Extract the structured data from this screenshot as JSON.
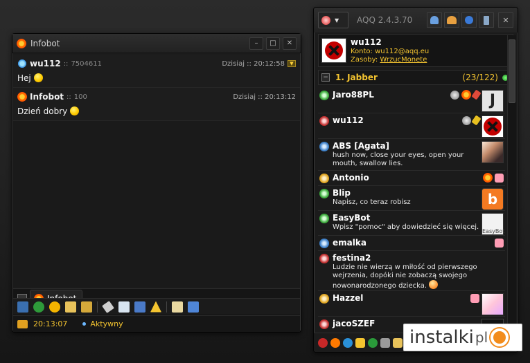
{
  "chat": {
    "title": "Infobot",
    "messages": [
      {
        "name": "wu112",
        "sep": "::",
        "uin": "7504611",
        "time": "Dzisiaj :: 20:12:58",
        "text": "Hej"
      },
      {
        "name": "Infobot",
        "sep": "::",
        "uin": "100",
        "time": "Dzisiaj :: 20:13:12",
        "text": "Dzień dobry"
      }
    ],
    "tab_label": "Infobot",
    "status_time": "20:13:07",
    "status_text": "Aktywny"
  },
  "contact_list": {
    "app_name": "AQQ 2.4.3.70",
    "profile": {
      "name": "wu112",
      "konto_label": "Konto:",
      "konto_value": "wu112@aqq.eu",
      "zasoby_label": "Zasoby:",
      "zasoby_value": "WrzucMonete"
    },
    "group": {
      "toggle": "−",
      "name": "1. Jabber",
      "count": "(23/122)"
    },
    "contacts": [
      {
        "name": "Jaro88PL",
        "desc": "",
        "status": "avail"
      },
      {
        "name": "wu112",
        "desc": "",
        "status": "busy"
      },
      {
        "name": "ABS [Agata]",
        "desc": "hush now, close your eyes, open your mouth, swallow lies.",
        "status": "idle"
      },
      {
        "name": "Antonio",
        "desc": "",
        "status": "away"
      },
      {
        "name": "Blip",
        "desc": "Napisz, co teraz robisz",
        "status": "avail"
      },
      {
        "name": "EasyBot",
        "desc": "Wpisz \"pomoc\" aby dowiedzieć się więcej.",
        "status": "avail"
      },
      {
        "name": "emalka",
        "desc": "",
        "status": "idle"
      },
      {
        "name": "festina2",
        "desc": "Ludzie nie wierzą w miłość od pierwszego wejrzenia, dopóki nie zobaczą swojego nowonarodzonego dziecka.",
        "status": "busy"
      },
      {
        "name": "Hazzel",
        "desc": "",
        "status": "away"
      },
      {
        "name": "jacoSZEF",
        "desc": "",
        "status": "busy"
      }
    ],
    "avatar_texts": {
      "jaro": "J",
      "blip": "b",
      "easybot": "EasyBot"
    }
  },
  "watermark": {
    "text": "instalki",
    "suffix": "pl"
  },
  "colors": {
    "accent": "#f4c430",
    "background": "#1b1b1b",
    "link": "#f4c430"
  }
}
